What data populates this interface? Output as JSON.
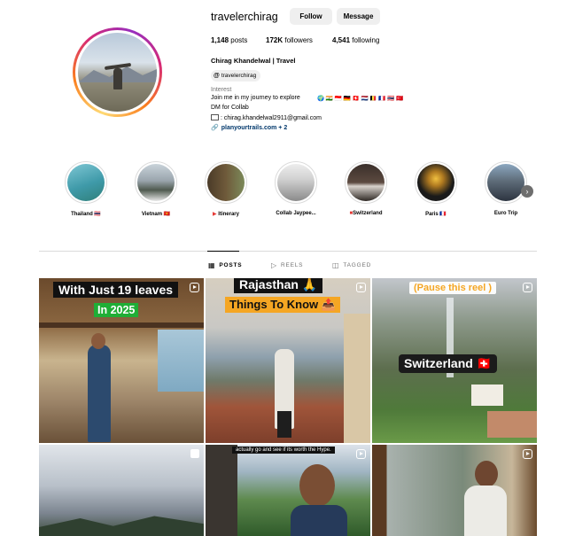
{
  "profile": {
    "username": "travelerchirag",
    "follow_label": "Follow",
    "message_label": "Message",
    "stats": [
      {
        "value": "1,148",
        "label": "posts"
      },
      {
        "value": "172K",
        "label": "followers"
      },
      {
        "value": "4,541",
        "label": "following"
      }
    ],
    "full_name": "Chirag Khandelwal | Travel",
    "threads_handle": "travelerchirag",
    "category": "Interest",
    "bio_line1": "Join me in my journey to explore",
    "bio_flags": "🌍 🇮🇳 🇮🇩 🇩🇪 🇨🇭 🇳🇱 🇧🇪 🇫🇷 🇹🇭 🇹🇷",
    "bio_line2": "DM for Collab",
    "bio_line3": ": chirag.khandelwal2911@gmail.com",
    "link_text": "planyourtrails.com + 2"
  },
  "highlights": [
    {
      "label": "Thailand 🇹🇭"
    },
    {
      "label": "Vietnam 🇻🇳"
    },
    {
      "label": "Itinerary"
    },
    {
      "label": "Collab Jaypee..."
    },
    {
      "label": "Switzerland"
    },
    {
      "label": "Paris 🇫🇷"
    },
    {
      "label": "Euro Trip"
    }
  ],
  "tabs": {
    "posts": "POSTS",
    "reels": "REELS",
    "tagged": "TAGGED"
  },
  "posts": {
    "p1_cap1": "With Just 19 leaves",
    "p1_cap2": "In 2025",
    "p2_cap1": "Rajasthan 🙏",
    "p2_cap2": "Things To Know 📤",
    "p3_cap1": "(Pause this reel )",
    "p3_cap2": "Switzerland 🇨🇭",
    "p5_cap1": "actually go and see if its worth the Hype."
  },
  "colors": {
    "accent_blue": "#0095f6",
    "link_blue": "#00376b",
    "caption_green": "#1fae36",
    "caption_orange": "#f5a623"
  }
}
